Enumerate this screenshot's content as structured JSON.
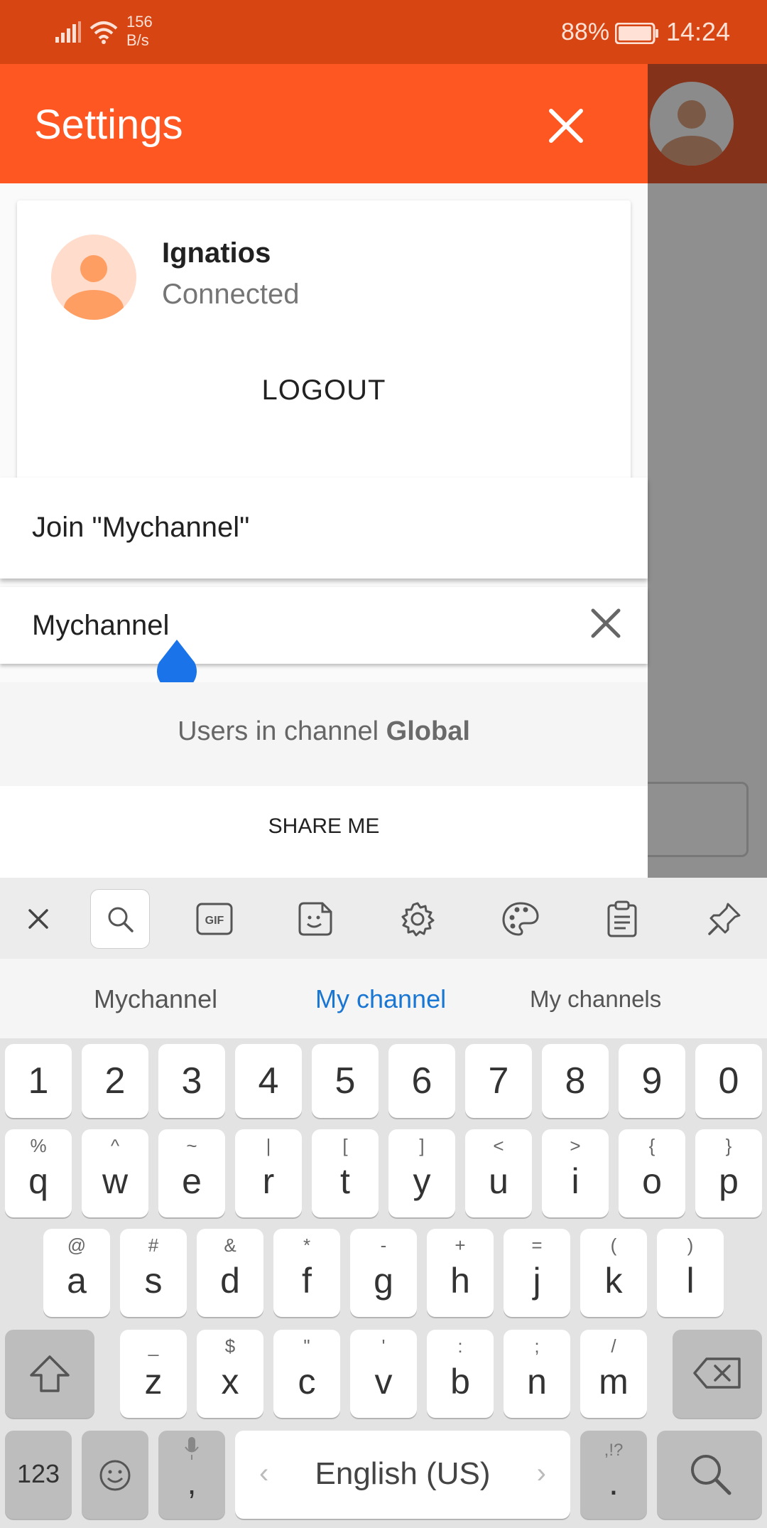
{
  "status_bar": {
    "net_speed_value": "156",
    "net_speed_unit": "B/s",
    "battery_percent": "88%",
    "time": "14:24"
  },
  "drawer": {
    "title": "Settings",
    "profile": {
      "name": "Ignatios",
      "status": "Connected",
      "logout_label": "LOGOUT"
    },
    "suggestion": "Join \"Mychannel\"",
    "search": {
      "value": "Mychannel"
    },
    "users_prefix": "Users in channel ",
    "users_channel": "Global",
    "share_label": "SHARE ME"
  },
  "keyboard": {
    "toolbar_icons": [
      "close-icon",
      "search-icon",
      "gif-icon",
      "sticker-icon",
      "gear-icon",
      "palette-icon",
      "clipboard-icon",
      "pin-icon"
    ],
    "gif_label": "GIF",
    "suggestions": [
      "Mychannel",
      "My channel",
      "My channels"
    ],
    "row_numbers": [
      "1",
      "2",
      "3",
      "4",
      "5",
      "6",
      "7",
      "8",
      "9",
      "0"
    ],
    "row1": {
      "keys": [
        "q",
        "w",
        "e",
        "r",
        "t",
        "y",
        "u",
        "i",
        "o",
        "p"
      ],
      "subs": [
        "%",
        "^",
        "~",
        "|",
        "[",
        "]",
        "<",
        ">",
        "{",
        "}"
      ]
    },
    "row2": {
      "keys": [
        "a",
        "s",
        "d",
        "f",
        "g",
        "h",
        "j",
        "k",
        "l"
      ],
      "subs": [
        "@",
        "#",
        "&",
        "*",
        "-",
        "+",
        "=",
        "(",
        ")"
      ]
    },
    "row3": {
      "keys": [
        "z",
        "x",
        "c",
        "v",
        "b",
        "n",
        "m"
      ],
      "subs": [
        "_",
        "$",
        "\"",
        "'",
        ":",
        ";",
        "/"
      ]
    },
    "bottom": {
      "num_label": "123",
      "comma": ",",
      "space_label": "English (US)",
      "left_arrow": "‹",
      "right_arrow": "›",
      "period": ".",
      "period_sub": ",!?"
    }
  }
}
